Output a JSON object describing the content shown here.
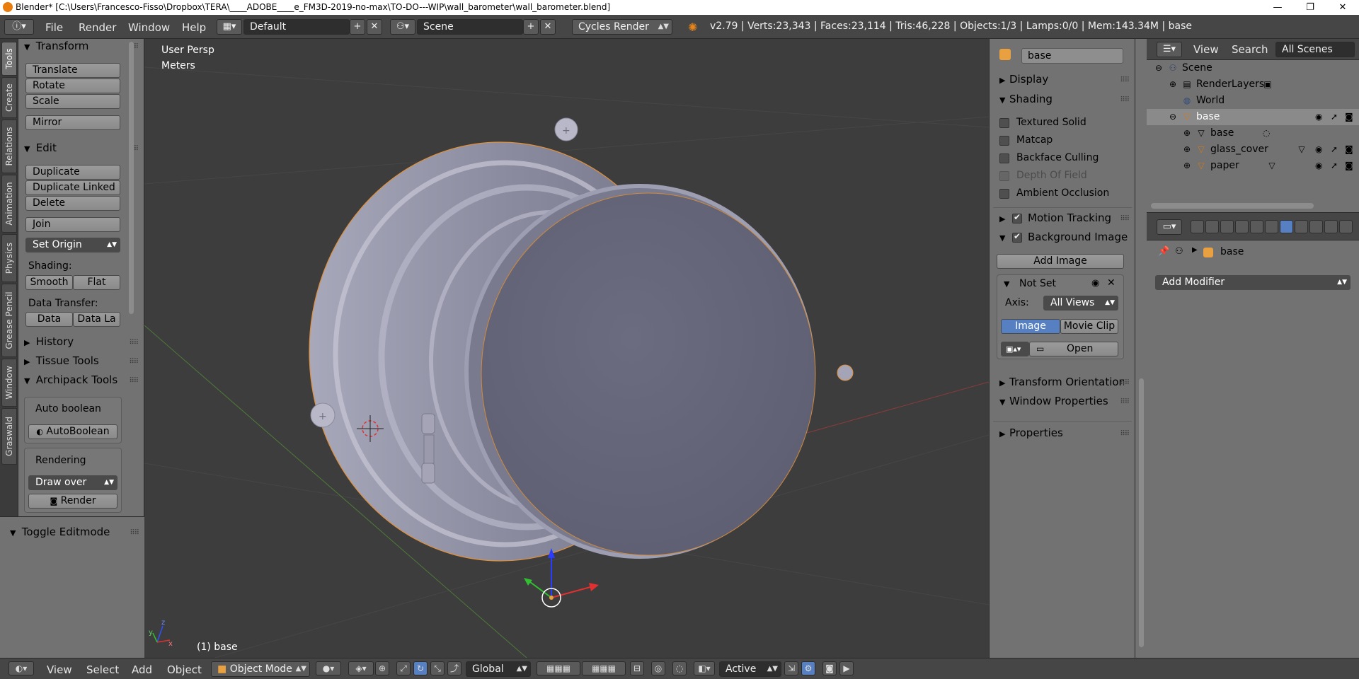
{
  "window": {
    "title": "Blender* [C:\\Users\\Francesco-Fisso\\Dropbox\\TERA\\____ADOBE____e_FM3D-2019-no-max\\TO-DO---WIP\\wall_barometer\\wall_barometer.blend]",
    "minimize": "—",
    "maximize": "❐",
    "close": "✕"
  },
  "info_header": {
    "menus": [
      "File",
      "Render",
      "Window",
      "Help"
    ],
    "screen_layout": "Default",
    "scene": "Scene",
    "render_engine": "Cycles Render",
    "stats": "v2.79 | Verts:23,343 | Faces:23,114 | Tris:46,228 | Objects:1/3 | Lamps:0/0 | Mem:143.34M | base"
  },
  "tool_tabs": [
    "Tools",
    "Create",
    "Relations",
    "Animation",
    "Physics",
    "Grease Pencil",
    "Window",
    "Graswald"
  ],
  "toolshelf": {
    "transform": {
      "title": "Transform",
      "buttons": [
        "Translate",
        "Rotate",
        "Scale",
        "Mirror"
      ]
    },
    "edit": {
      "title": "Edit",
      "buttons": [
        "Duplicate",
        "Duplicate Linked",
        "Delete",
        "Join"
      ],
      "set_origin": "Set Origin",
      "shading_label": "Shading:",
      "smooth": "Smooth",
      "flat": "Flat",
      "data_transfer_label": "Data Transfer:",
      "data": "Data",
      "data_layout": "Data La"
    },
    "history": "History",
    "tissue_tools": "Tissue Tools",
    "archipack": {
      "title": "Archipack Tools",
      "auto_boolean_label": "Auto boolean",
      "auto_boolean_button": "AutoBoolean",
      "rendering_label": "Rendering",
      "draw_over": "Draw over",
      "render_button": "Render"
    }
  },
  "operator_panel": {
    "title": "Toggle Editmode"
  },
  "viewport": {
    "view_name": "User Persp",
    "units": "Meters",
    "active_object": "(1) base"
  },
  "npanel": {
    "object_name": "base",
    "sections": {
      "display": "Display",
      "shading": "Shading",
      "motion_tracking": "Motion Tracking",
      "background_images": "Background Images",
      "transform_orientations": "Transform Orientations",
      "window_properties": "Window Properties",
      "properties": "Properties"
    },
    "shading_options": [
      {
        "label": "Textured Solid",
        "checked": false,
        "enabled": true
      },
      {
        "label": "Matcap",
        "checked": false,
        "enabled": true
      },
      {
        "label": "Backface Culling",
        "checked": false,
        "enabled": true
      },
      {
        "label": "Depth Of Field",
        "checked": false,
        "enabled": false
      },
      {
        "label": "Ambient Occlusion",
        "checked": false,
        "enabled": true
      }
    ],
    "add_image": "Add Image",
    "bg_image_name": "Not Set",
    "axis_label": "Axis:",
    "axis_value": "All Views",
    "source_image": "Image",
    "source_movie": "Movie Clip",
    "open": "Open"
  },
  "outliner": {
    "header": {
      "view": "View",
      "search": "Search",
      "filter": "All Scenes"
    },
    "tree": [
      {
        "name": "Scene",
        "level": 0
      },
      {
        "name": "RenderLayers",
        "level": 1
      },
      {
        "name": "World",
        "level": 1
      },
      {
        "name": "base",
        "level": 1
      },
      {
        "name": "base",
        "level": 2
      },
      {
        "name": "glass_cover",
        "level": 2
      },
      {
        "name": "paper",
        "level": 2
      }
    ]
  },
  "properties_editor": {
    "breadcrumb_object": "base",
    "add_modifier": "Add Modifier"
  },
  "bottom_header": {
    "menus": [
      "View",
      "Select",
      "Add",
      "Object"
    ],
    "mode": "Object Mode",
    "orientation": "Global",
    "proportional": "Active"
  }
}
